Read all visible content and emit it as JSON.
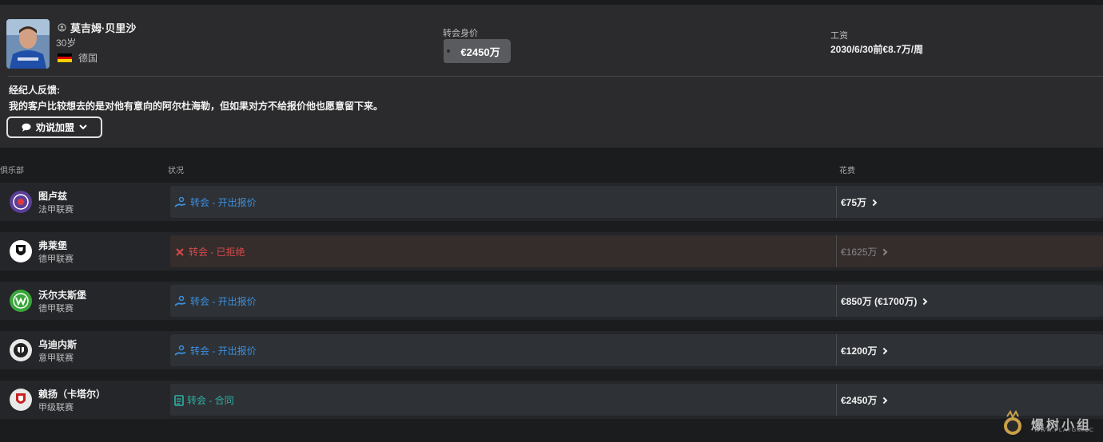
{
  "player": {
    "name": "莫吉姆·贝里沙",
    "age": "30岁",
    "nationality": "德国",
    "flag_colors": [
      "#000000",
      "#dd0000",
      "#ffce00"
    ]
  },
  "valuation": {
    "label": "转会身价",
    "value": "€2450万"
  },
  "wage": {
    "label": "工资",
    "value": "2030/6/30前€8.7万/周"
  },
  "agent": {
    "label": "经纪人反馈:",
    "text": "我的客户比较想去的是对他有意向的阿尔杜海勒，但如果对方不给报价他也愿意留下来。",
    "persuade_button": "劝说加盟"
  },
  "table": {
    "headers": {
      "club": "俱乐部",
      "status": "状况",
      "fee": "花费"
    },
    "rows": [
      {
        "club": "图卢兹",
        "league": "法甲联赛",
        "status": "转会 - 开出报价",
        "status_type": "offer",
        "fee": "€75万",
        "crest_color": "#5b3e96"
      },
      {
        "club": "弗莱堡",
        "league": "德甲联赛",
        "status": "转会 - 已拒绝",
        "status_type": "rejected",
        "fee": "€1625万",
        "crest_color": "#ffffff"
      },
      {
        "club": "沃尔夫斯堡",
        "league": "德甲联赛",
        "status": "转会 - 开出报价",
        "status_type": "offer",
        "fee": "€850万 (€1700万)",
        "crest_color": "#3aa53a"
      },
      {
        "club": "乌迪内斯",
        "league": "意甲联赛",
        "status": "转会 - 开出报价",
        "status_type": "offer",
        "fee": "€1200万",
        "crest_color": "#e8e8e8"
      },
      {
        "club": "赖扬（卡塔尔）",
        "league": "甲级联赛",
        "status": "转会 - 合同",
        "status_type": "contract",
        "fee": "€2450万",
        "crest_color": "#e8e8e8"
      }
    ]
  },
  "watermark": {
    "text": "爆树小组",
    "url": "WWW.PLAYGM.CC"
  }
}
